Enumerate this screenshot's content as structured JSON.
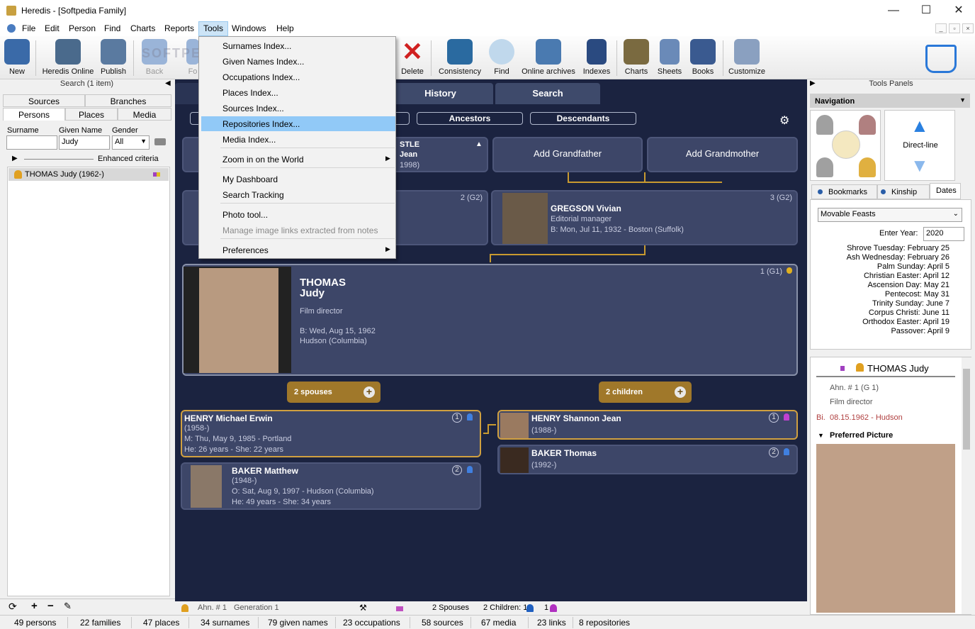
{
  "window": {
    "title": "Heredis - [Softpedia Family]",
    "min": "—",
    "max": "☐",
    "close": "✕"
  },
  "menu": [
    "File",
    "Edit",
    "Person",
    "Find",
    "Charts",
    "Reports",
    "Tools",
    "Windows",
    "Help"
  ],
  "toolbar": {
    "new": "New",
    "heredis_online": "Heredis Online",
    "publish": "Publish",
    "back": "Back",
    "fo": "Fo",
    "delete": "Delete",
    "consistency": "Consistency",
    "find": "Find",
    "online_archives": "Online archives",
    "indexes": "Indexes",
    "charts": "Charts",
    "sheets": "Sheets",
    "books": "Books",
    "customize": "Customize"
  },
  "tools_menu": {
    "surnames": "Surnames Index...",
    "given": "Given Names Index...",
    "occupations": "Occupations Index...",
    "places": "Places Index...",
    "sources": "Sources Index...",
    "repositories": "Repositories Index...",
    "media": "Media Index...",
    "zoom": "Zoom in on the World",
    "dashboard": "My Dashboard",
    "search_tracking": "Search Tracking",
    "photo_tool": "Photo tool...",
    "manage_links": "Manage image links extracted from notes",
    "preferences": "Preferences"
  },
  "left": {
    "search_title": "Search (1 item)",
    "tabs": [
      "Sources",
      "Branches",
      "Persons",
      "Places",
      "Media"
    ],
    "surname_lbl": "Surname",
    "given_lbl": "Given Name",
    "gender_lbl": "Gender",
    "given_val": "Judy",
    "gender_val": "All",
    "enhanced": "Enhanced criteria",
    "person": "THOMAS Judy (1962-)"
  },
  "center": {
    "tabs": {
      "history": "History",
      "search": "Search"
    },
    "pills": {
      "ancestors": "Ancestors",
      "descendants": "Descendants"
    },
    "gp_partial": {
      "l1": "STLE",
      "l2": "Jean",
      "l3": "1998)"
    },
    "add_grandfather": "Add Grandfather",
    "add_grandmother": "Add Grandmother",
    "father_gen": "2 (G2)",
    "mother": {
      "gen": "3 (G2)",
      "name": "GREGSON Vivian",
      "occ": "Editorial manager",
      "birth": "B: Mon, Jul 11, 1932 - Boston (Suffolk)"
    },
    "main": {
      "gen": "1 (G1)",
      "surname": "THOMAS",
      "given": "Judy",
      "occ": "Film director",
      "birth": "B: Wed, Aug 15, 1962",
      "place": "Hudson (Columbia)"
    },
    "spouses_btn": "2 spouses",
    "children_btn": "2 children",
    "spouse1": {
      "name": "HENRY Michael Erwin",
      "years": "(1958-)",
      "marr": "M: Thu, May 9, 1985 - Portland",
      "ages": "He: 26 years - She: 22 years",
      "num": "1"
    },
    "spouse2": {
      "name": "BAKER Matthew",
      "years": "(1948-)",
      "marr": "O: Sat, Aug 9, 1997 - Hudson (Columbia)",
      "ages": "He: 49 years - She: 34 years",
      "num": "2"
    },
    "child1": {
      "name": "HENRY Shannon Jean",
      "years": "(1988-)",
      "num": "1"
    },
    "child2": {
      "name": "BAKER Thomas",
      "years": "(1992-)",
      "num": "2"
    }
  },
  "right": {
    "tools_panels": "Tools Panels",
    "navigation": "Navigation",
    "direct_line": "Direct-line",
    "tabs": [
      "Bookmarks",
      "Kinship",
      "Dates"
    ],
    "feast_select": "Movable Feasts",
    "enter_year": "Enter Year:",
    "year": "2020",
    "dates": [
      "Shrove Tuesday: February 25",
      "Ash Wednesday: February 26",
      "Palm Sunday: April 5",
      "Christian Easter: April 12",
      "Ascension Day: May 21",
      "Pentecost: May 31",
      "Trinity Sunday: June 7",
      "Corpus Christi: June 11",
      "Orthodox Easter: April 19",
      "Passover: April 9"
    ],
    "person_name": "THOMAS Judy",
    "ahn": "Ahn. # 1 (G 1)",
    "occ": "Film director",
    "bi_lbl": "Bi.",
    "bi_val": "08.15.1962 - Hudson",
    "preferred": "Preferred Picture"
  },
  "subbar": {
    "ahn": "Ahn. # 1",
    "generation": "Generation 1",
    "spouses": "2 Spouses",
    "children": "2 Children: 1",
    "one": "1"
  },
  "status": [
    "49 persons",
    "22 families",
    "47 places",
    "34 surnames",
    "79 given names",
    "23  occupations",
    "58 sources",
    "67  media",
    "23 links",
    "8 repositories"
  ],
  "watermark": "SOFTPEDIA"
}
